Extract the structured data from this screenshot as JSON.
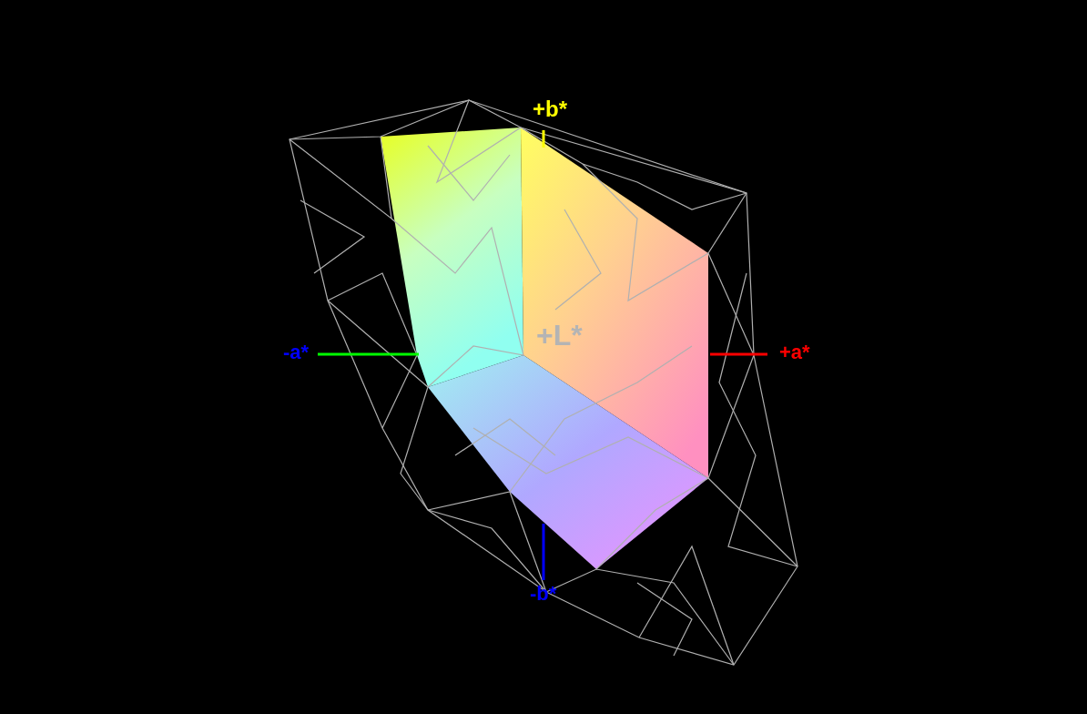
{
  "axes": [
    {
      "label": "+b*",
      "color": "#ffff00"
    },
    {
      "label": "-a*",
      "color": "#0000ff"
    },
    {
      "label": "+L*",
      "color": "#b4b4b4"
    },
    {
      "label": "+a*",
      "color": "#ff0000"
    },
    {
      "label": "-b*",
      "color": "#0000ff"
    }
  ],
  "axis_lines": [
    {
      "color": "#ffff00"
    },
    {
      "color": "#00ff00"
    },
    {
      "color": "#ff0000"
    },
    {
      "color": "#0000ff"
    }
  ]
}
